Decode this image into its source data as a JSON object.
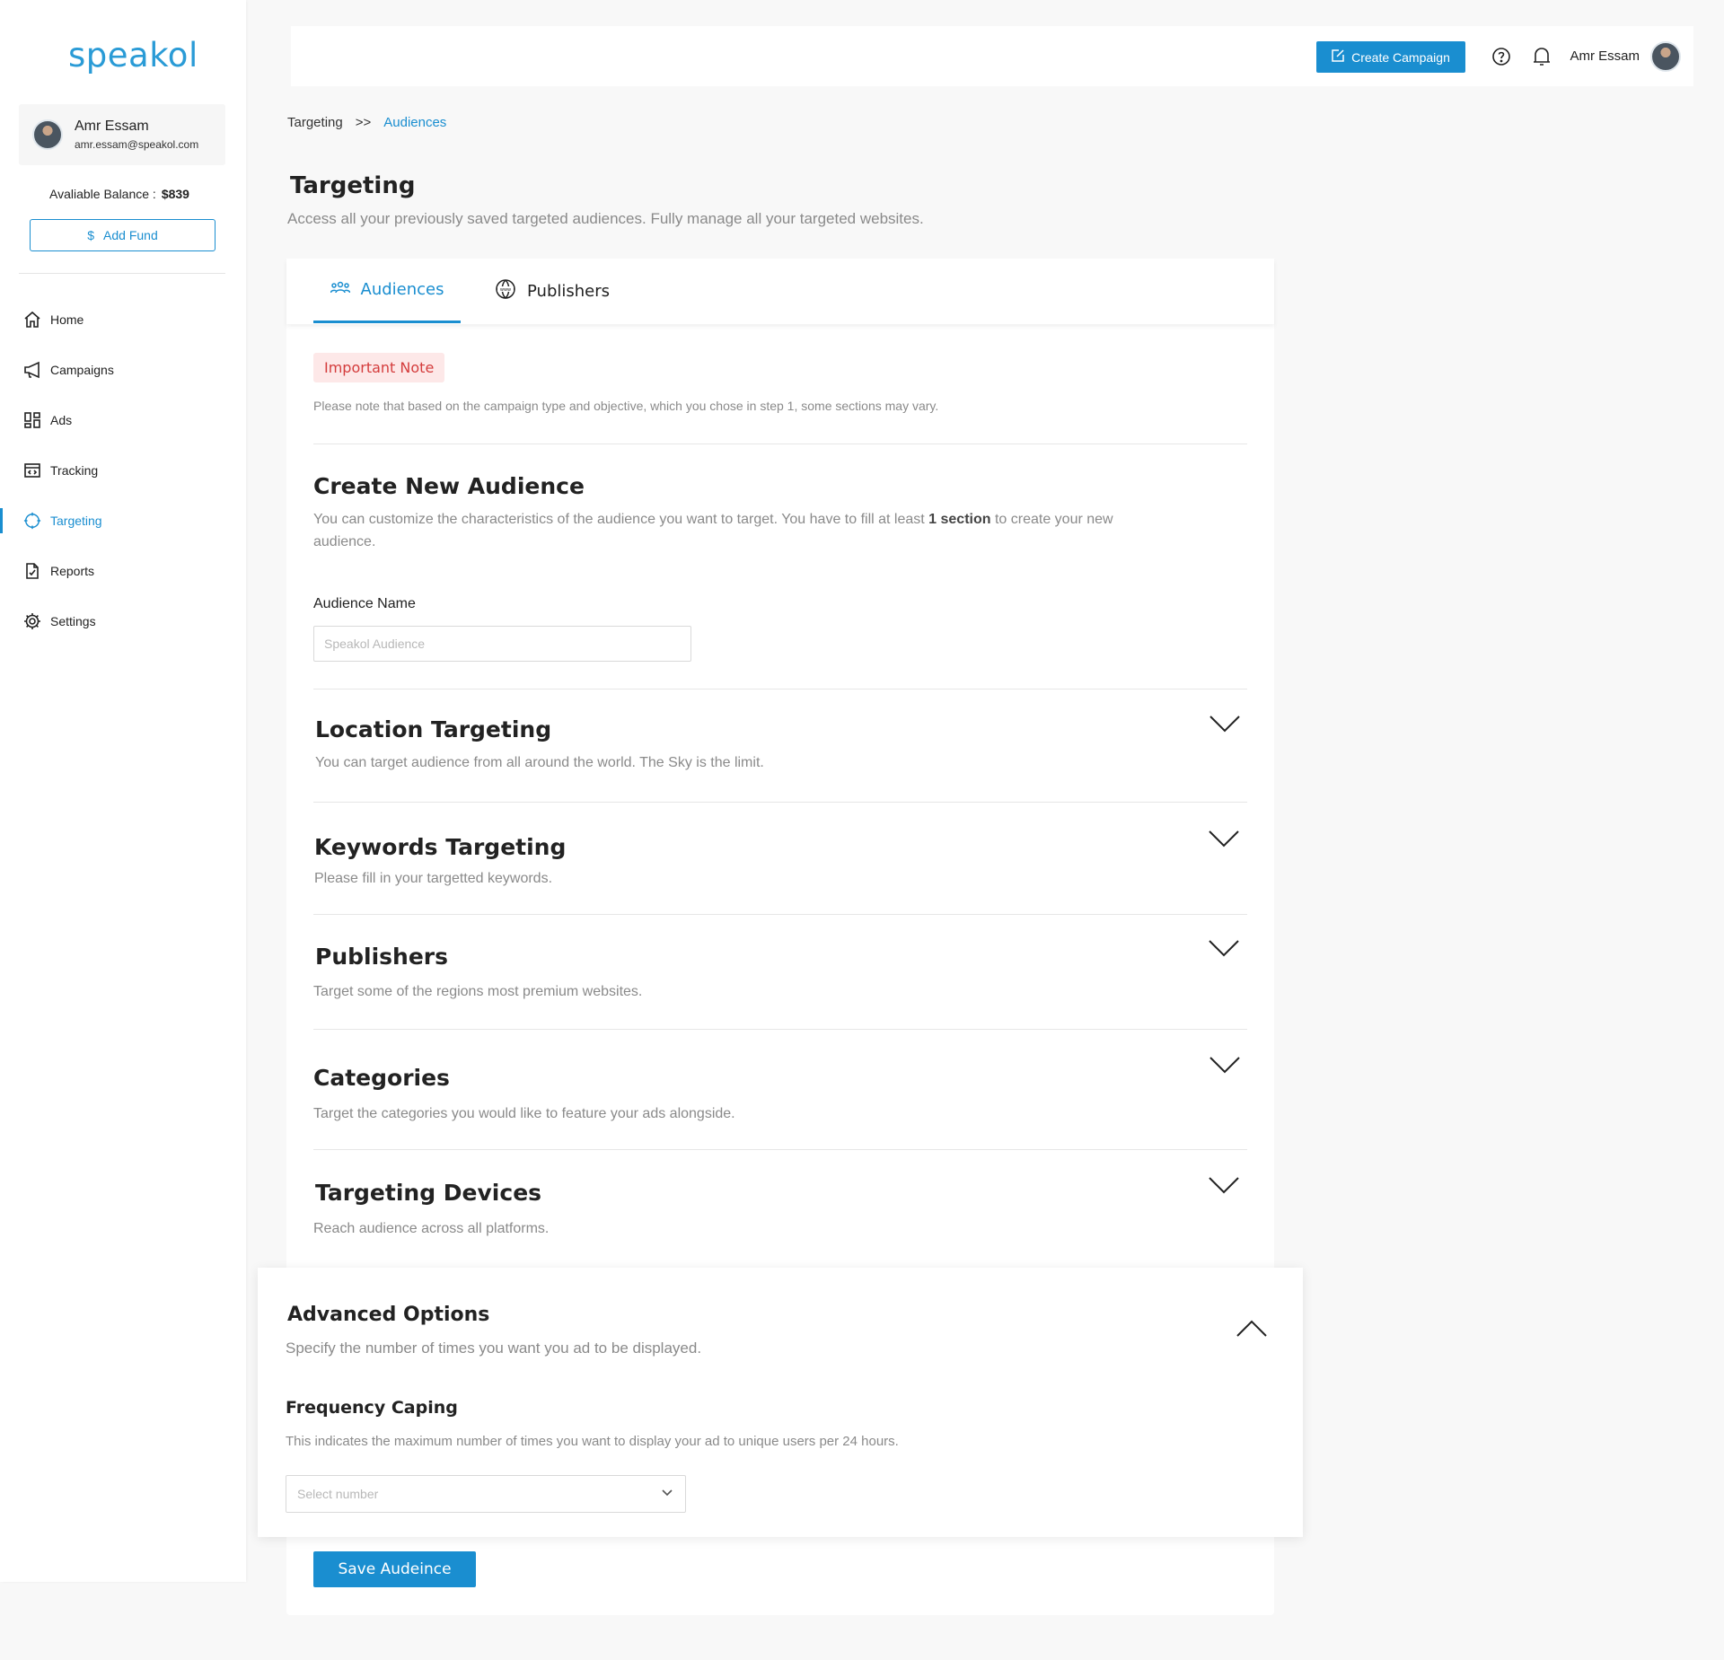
{
  "brand": {
    "logo_text": "speakol",
    "accent": "#1a8ed0",
    "error": "#d43c3c"
  },
  "sidebar": {
    "user": {
      "name": "Amr Essam",
      "email": "amr.essam@speakol.com"
    },
    "balance_label": "Avaliable Balance :",
    "balance_value": "$839",
    "add_fund_label": "Add Fund",
    "add_fund_icon": "dollar-icon",
    "items": [
      {
        "label": "Home",
        "icon": "home-icon",
        "active": false
      },
      {
        "label": "Campaigns",
        "icon": "megaphone-icon",
        "active": false
      },
      {
        "label": "Ads",
        "icon": "grid-icon",
        "active": false
      },
      {
        "label": "Tracking",
        "icon": "code-window-icon",
        "active": false
      },
      {
        "label": "Targeting",
        "icon": "crosshair-icon",
        "active": true
      },
      {
        "label": "Reports",
        "icon": "report-icon",
        "active": false
      },
      {
        "label": "Settings",
        "icon": "gear-icon",
        "active": false
      }
    ]
  },
  "topbar": {
    "create_label": "Create Campaign",
    "create_icon": "edit-icon",
    "help_icon": "help-icon",
    "bell_icon": "bell-icon",
    "user_name": "Amr Essam"
  },
  "breadcrumb": {
    "parent": "Targeting",
    "separator": ">>",
    "current": "Audiences"
  },
  "page": {
    "title": "Targeting",
    "subtitle": "Access all your previously saved targeted audiences. Fully manage all your targeted websites."
  },
  "tabs": [
    {
      "label": "Audiences",
      "icon": "people-icon",
      "active": true
    },
    {
      "label": "Publishers",
      "icon": "www-icon",
      "active": false
    }
  ],
  "note": {
    "badge": "Important Note",
    "text": "Please note that based on the campaign type and objective, which you chose in step 1, some sections may vary."
  },
  "create_audience": {
    "title": "Create New Audience",
    "sub_before": "You can customize the characteristics of the audience you want to target. You have to fill at least ",
    "sub_bold": "1 section",
    "sub_after": " to create your new audience.",
    "field_label": "Audience Name",
    "field_placeholder": "Speakol Audience",
    "field_value": ""
  },
  "sections": [
    {
      "title": "Location Targeting",
      "sub": "You can target audience from all around the world. The Sky is the limit."
    },
    {
      "title": "Keywords Targeting",
      "sub": "Please fill in your targetted keywords."
    },
    {
      "title": "Publishers",
      "sub": "Target some of the regions most premium websites."
    },
    {
      "title": "Categories",
      "sub": "Target the categories you would like to feature your ads alongside."
    },
    {
      "title": "Targeting Devices",
      "sub": "Reach audience across all platforms."
    }
  ],
  "advanced": {
    "title": "Advanced Options",
    "sub": "Specify the number of times you want you ad to be displayed.",
    "label": "Frequency Caping",
    "text": "This indicates the maximum number of times you want to display your ad to unique users per 24 hours.",
    "select_placeholder": "Select number"
  },
  "save_label": "Save Audeince"
}
